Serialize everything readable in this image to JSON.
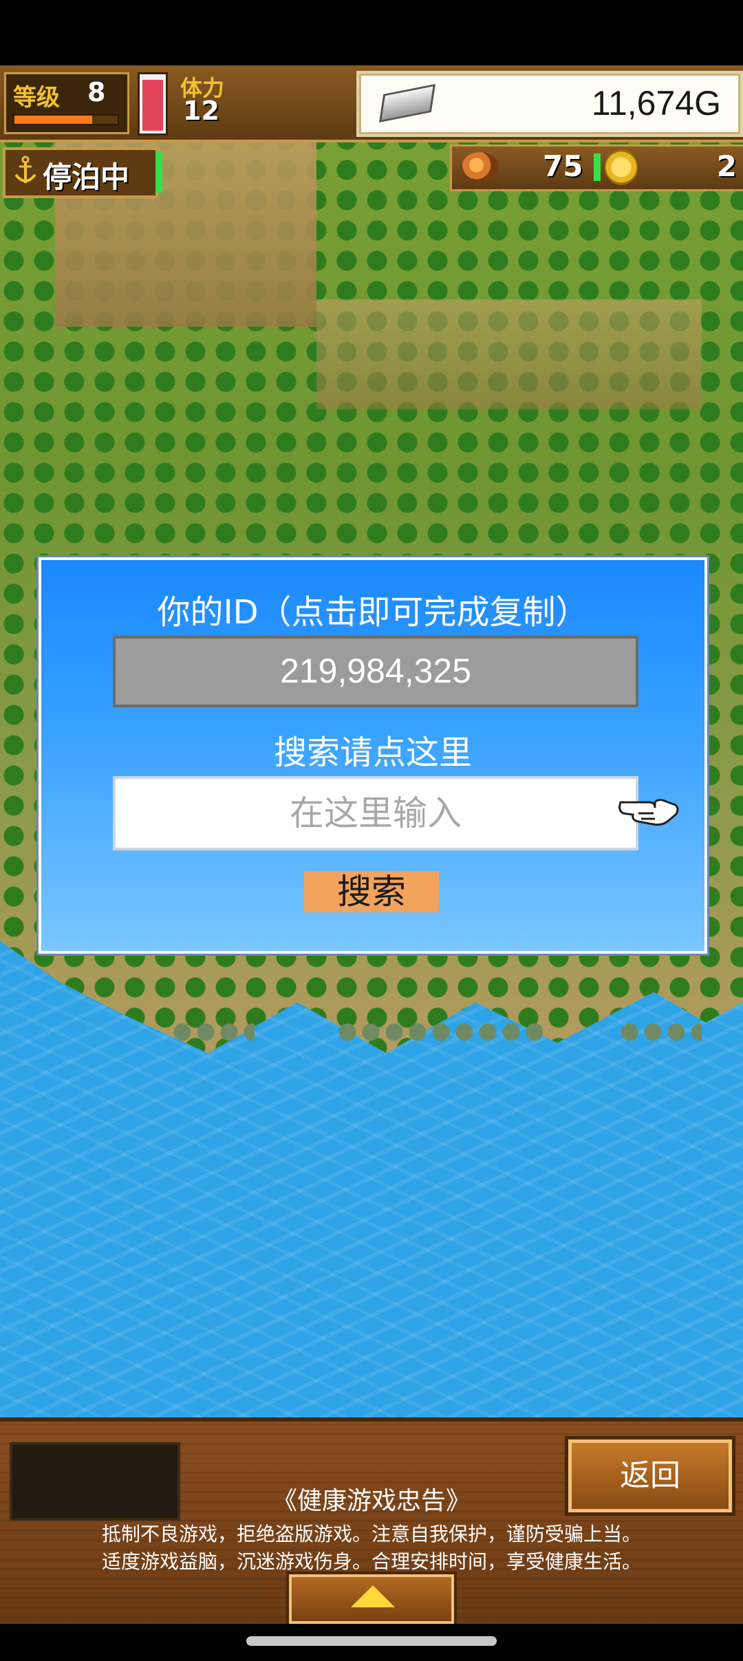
{
  "hud": {
    "level_label": "等级",
    "level_value": "8",
    "level_progress": 0.75,
    "stamina_label": "体力",
    "stamina_value": "12",
    "stamina_fill": 0.95,
    "gold": "11,674G",
    "status": "停泊中",
    "food_value": "75",
    "coin_value": "2"
  },
  "dialog": {
    "title": "你的ID（点击即可完成复制）",
    "user_id": "219,984,325",
    "search_label": "搜索请点这里",
    "search_placeholder": "在这里输入",
    "search_value": "",
    "search_button": "搜索"
  },
  "bottom": {
    "back_button": "返回",
    "notice_title": "《健康游戏忠告》",
    "notice_line1": "抵制不良游戏，拒绝盗版游戏。注意自我保护，谨防受骗上当。",
    "notice_line2": "适度游戏益脑，沉迷游戏伤身。合理安排时间，享受健康生活。"
  },
  "icons": {
    "anchor": "anchor-icon",
    "silver_bar": "silver-bar-icon",
    "food": "food-icon",
    "coin": "coin-icon",
    "pointing_hand": "pointing-hand-icon",
    "arrow_up": "arrow-up-icon"
  },
  "colors": {
    "dialog_bg": "#3aa2ff",
    "search_button": "#f2a35c",
    "wood_panel": "#7a4418",
    "hud_gold_text": "#f2c233",
    "sea": "#2ea3e6"
  }
}
